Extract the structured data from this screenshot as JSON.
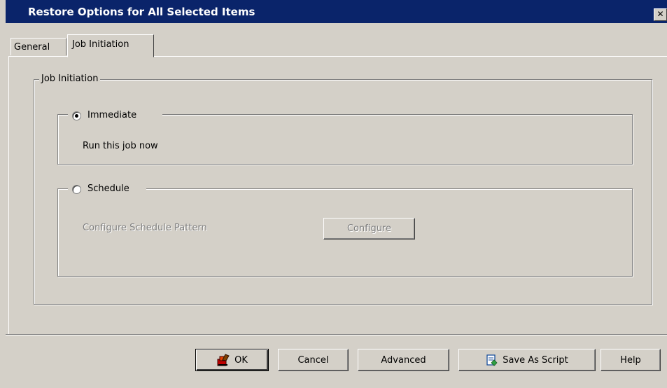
{
  "window": {
    "title": "Restore Options for All Selected Items",
    "close_label": "✕"
  },
  "tabs": [
    {
      "label": "General"
    },
    {
      "label": "Job Initiation"
    }
  ],
  "job_initiation": {
    "group_label": "Job Initiation",
    "immediate": {
      "label": "Immediate",
      "selected": true,
      "description": "Run this job now"
    },
    "schedule": {
      "label": "Schedule",
      "selected": false,
      "pattern_label": "Configure Schedule Pattern",
      "configure_button": "Configure"
    }
  },
  "buttons": {
    "ok": "OK",
    "cancel": "Cancel",
    "advanced": "Advanced",
    "save_as_script": "Save As Script",
    "help": "Help"
  },
  "icons": {
    "ok": "ok-check-icon",
    "save_as_script": "script-icon"
  }
}
